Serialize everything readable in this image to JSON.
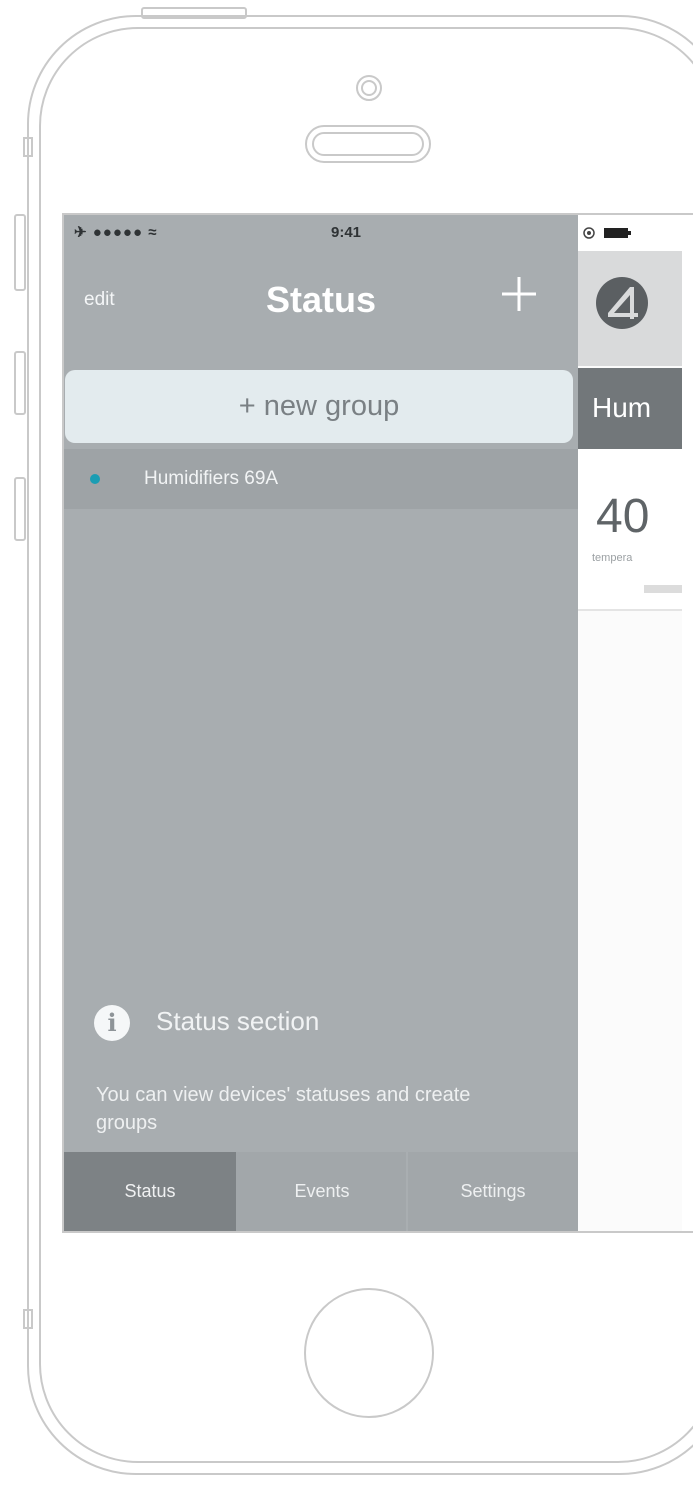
{
  "status_bar": {
    "left": "✈ ●●●●● ≈",
    "time": "9:41",
    "right_indicators": "battery-icon"
  },
  "nav": {
    "edit_label": "edit",
    "title": "Status",
    "add_icon": "plus-icon"
  },
  "new_group_label": "+ new group",
  "groups": [
    {
      "label": "Humidifiers 69A",
      "dot_color": "#1b9db3"
    }
  ],
  "info": {
    "icon": "info-icon",
    "icon_glyph": "i",
    "title": "Status section",
    "text": "You can view devices' statuses and create groups"
  },
  "tabs": [
    {
      "label": "Status",
      "active": true
    },
    {
      "label": "Events",
      "active": false
    },
    {
      "label": "Settings",
      "active": false
    }
  ],
  "peek": {
    "tab_label": "Hum",
    "value": "40",
    "sub_label": "tempera"
  },
  "colors": {
    "drawer_bg": "#a8adb0",
    "active_tab": "#7d8285",
    "accent_dot": "#1b9db3",
    "new_group_bg": "#e3ebee"
  }
}
